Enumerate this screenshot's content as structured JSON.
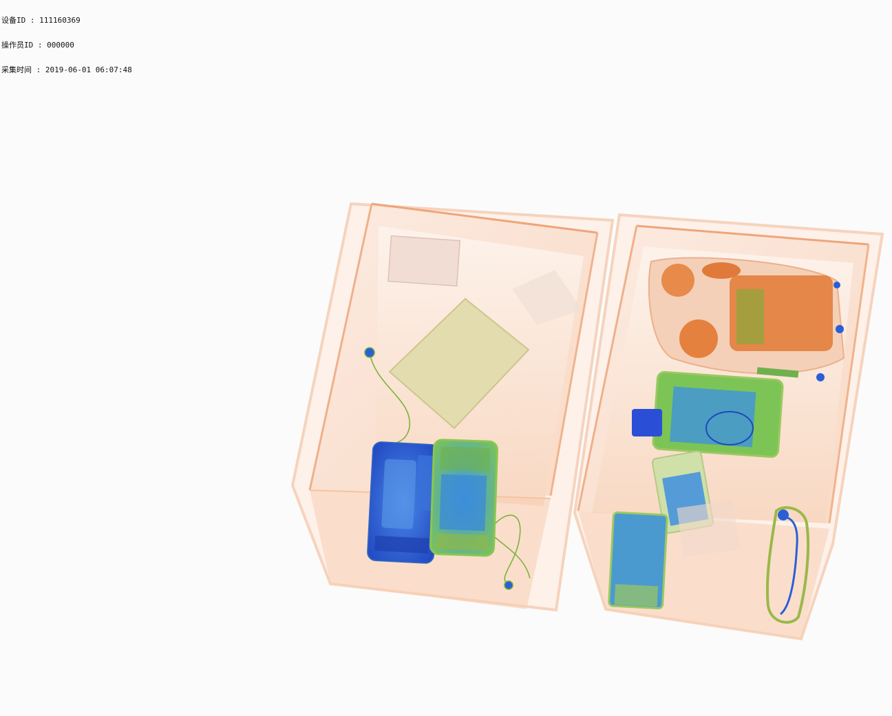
{
  "overlay": {
    "device_id": "设备ID : 111160369",
    "operator_id": "操作员ID : 000000",
    "capture_time": "采集时间 : 2019-06-01 06:07:48"
  },
  "colors": {
    "background": "#fbfbfb",
    "bin_organic": "#f0a070",
    "bin_edge": "#e58a55",
    "heavy_organic": "#e0702a",
    "metal_blue": "#2a5fd6",
    "mixed_green": "#5fb84a",
    "light_olive": "#d9d6a8"
  }
}
